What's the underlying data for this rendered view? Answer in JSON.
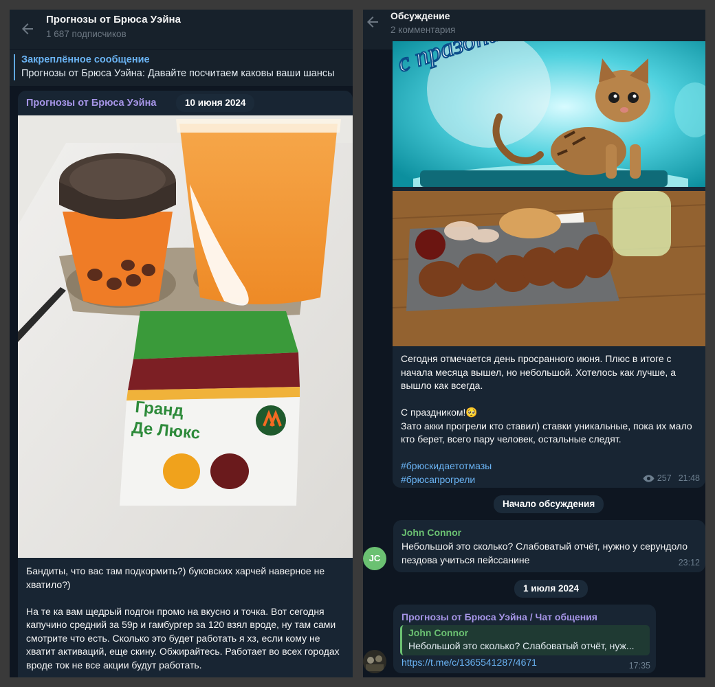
{
  "left": {
    "header": {
      "title": "Прогнозы от Брюса Уэйна",
      "subtitle": "1 687 подписчиков"
    },
    "pinned": {
      "title": "Закреплённое сообщение",
      "text": "Прогнозы от Брюса Уэйна: Давайте посчитаем каковы ваши шансы"
    },
    "post": {
      "channel": "Прогнозы от Брюса Уэйна",
      "date": "10 июня 2024",
      "image_labels": {
        "burger_name": "Гранд\nДе Люкс"
      },
      "text_p1": "Бандиты, что вас там подкормить?) буковских харчей наверное не хватило?)",
      "text_p2": "На те ка вам щедрый подгон промо на вкусно и точка. Вот сегодня капучино средний за 59р и гамбургер за 120 взял вроде, ну там сами смотрите что есть. Сколько это будет работать я хз, если кому не хватит активаций, еще скину. Обжирайтесь. Работает во всех городах вроде ток не все акции будут работать."
    }
  },
  "right": {
    "header": {
      "title": "Обсуждение",
      "subtitle": "2 комментария"
    },
    "post": {
      "text_p1": "Сегодня отмечается день просранного июня. Плюс в итоге с начала месяца вышел, но небольшой. Хотелось как лучше, а вышло как всегда.",
      "text_p2a": "С праздником!🥺",
      "text_p2b": "Зато акки прогрели кто ставил) ставки уникальные, пока их мало кто берет, всего пару человек, остальные следят.",
      "hashtag1": "#брюскидаетотмазы",
      "hashtag2": "#брюсапрогрели",
      "views": "257",
      "time": "21:48",
      "image_text": "с праздником"
    },
    "discussion_start": "Начало обсуждения",
    "comment1": {
      "author": "John Connor",
      "avatar_initials": "JC",
      "text": "Небольшой это сколько? Слабоватый отчёт, нужно у серундоло пездова учиться пейссанине",
      "time": "23:12"
    },
    "date2": "1 июля 2024",
    "comment2": {
      "author": "Прогнозы от Брюса Уэйна / Чат общения",
      "reply_author": "John Connor",
      "reply_text": "Небольшой это сколько? Слабоватый отчёт, нуж...",
      "link": "https://t.me/c/1365541287/4671",
      "time": "17:35"
    }
  },
  "colors": {
    "bg_panel": "#0e1621",
    "header": "#17212b",
    "bubble": "#182533",
    "accent_link": "#6ab3f3",
    "channel_name": "#a695e7",
    "author_green": "#6bc172"
  },
  "icons": [
    "back-arrow-icon",
    "views-eye-icon"
  ]
}
